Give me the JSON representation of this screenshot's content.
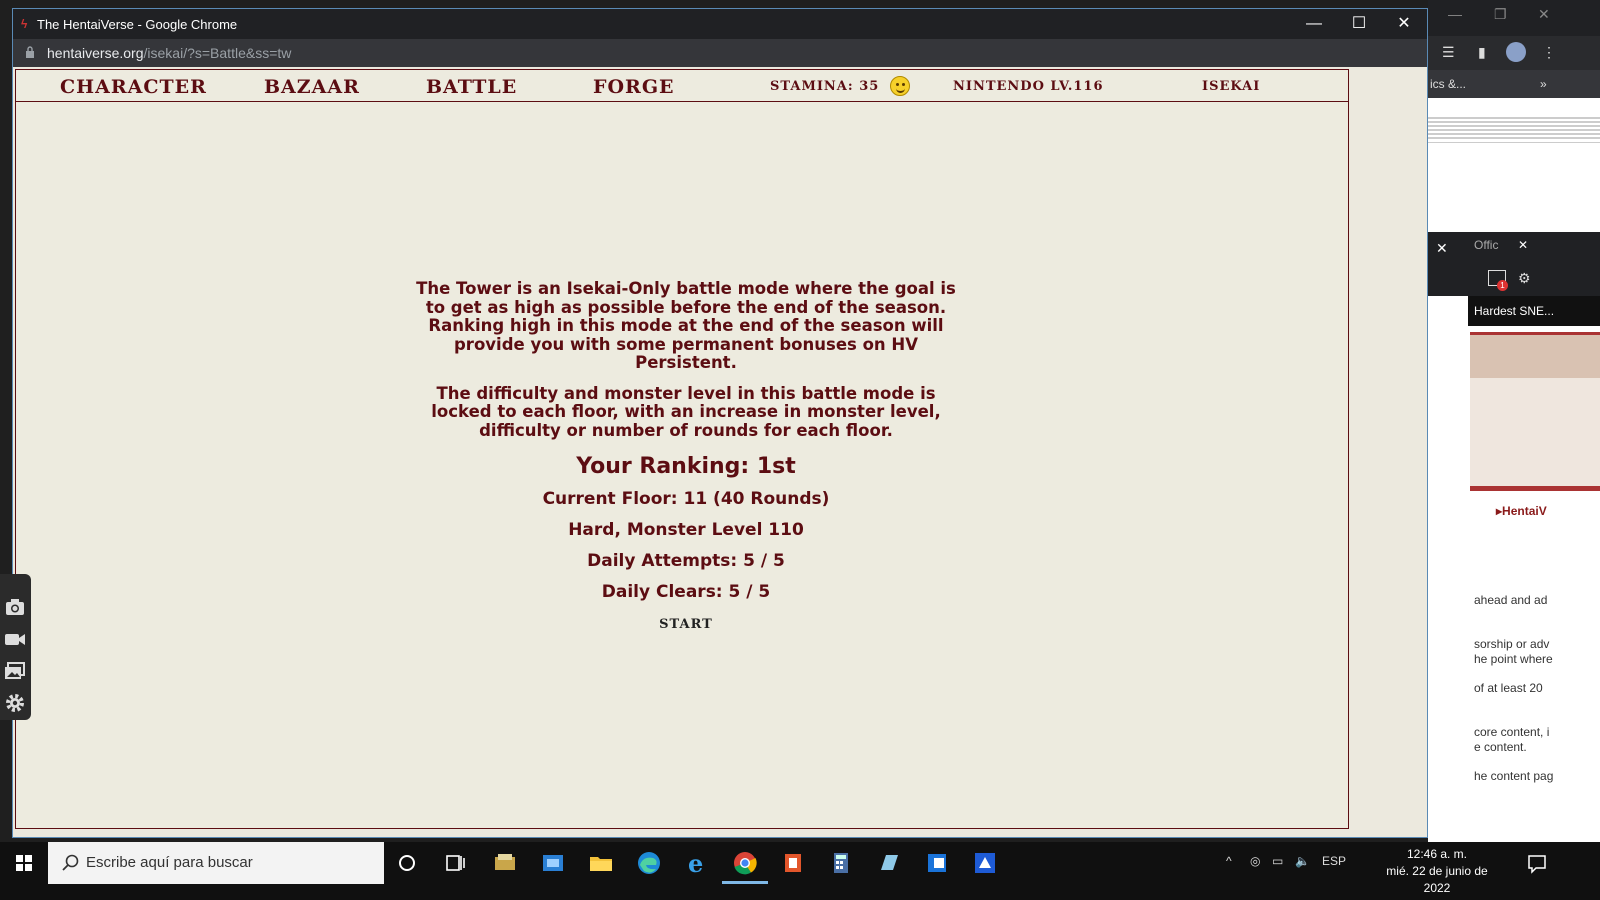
{
  "window": {
    "title": "The HentaiVerse - Google Chrome",
    "url_host": "hentaiverse.org",
    "url_path": "/isekai/?s=Battle&ss=tw"
  },
  "nav": {
    "character": "Character",
    "bazaar": "Bazaar",
    "battle": "Battle",
    "forge": "Forge",
    "stamina": "Stamina: 35",
    "player": "Nintendo Lv.116",
    "mode": "Isekai"
  },
  "tower": {
    "description_1": "The Tower is an Isekai-Only battle mode where the goal is to get as high as possible before the end of the season. Ranking high in this mode at the end of the season will provide you with some permanent bonuses on HV Persistent.",
    "description_2": "The difficulty and monster level in this battle mode is locked to each floor, with an increase in monster level, difficulty or number of rounds for each floor.",
    "ranking": "Your Ranking: 1st",
    "current_floor": "Current Floor: 11 (40 Rounds)",
    "difficulty": "Hard, Monster Level 110",
    "daily_attempts": "Daily Attempts: 5 / 5",
    "daily_clears": "Daily Clears: 5 / 5",
    "start_label": "Start"
  },
  "background_window": {
    "toolbar_text": "ics &...",
    "panel_tab": "Offic",
    "video_title": "Hardest SNE...",
    "link_text": "HentaiV",
    "badge_count": "1",
    "snippets": [
      "ahead and ad",
      "sorship or adv",
      "he point where",
      "of at least 20",
      "core content, i",
      "e content.",
      "he content pag"
    ]
  },
  "taskbar": {
    "search_placeholder": "Escribe aquí para buscar",
    "language": "ESP",
    "time": "12:46 a. m.",
    "date": "mié. 22 de junio de 2022"
  },
  "colors": {
    "hv_text": "#5c0d12",
    "hv_background": "#edebdf",
    "chrome_dark": "#202124"
  }
}
